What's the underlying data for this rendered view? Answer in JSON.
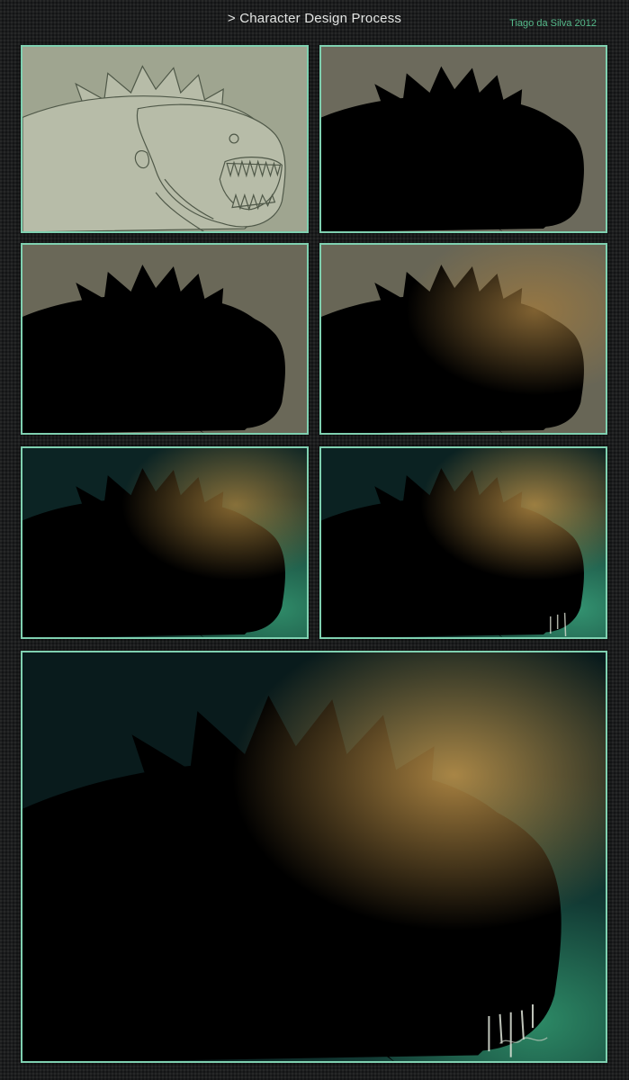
{
  "header": {
    "title": "> Character Design Process",
    "author": "Tiago da Silva 2012"
  },
  "stages": [
    {
      "name": "sketch"
    },
    {
      "name": "flat-color"
    },
    {
      "name": "base-shading"
    },
    {
      "name": "lighting"
    },
    {
      "name": "background-color"
    },
    {
      "name": "details"
    },
    {
      "name": "final-render"
    }
  ],
  "colors": {
    "accent_border": "#7fd0b0",
    "author_text": "#55b98a",
    "background": "#1c1d1e",
    "sketch_paper": "#9fa590",
    "bg_gray": "#6c6a5c",
    "bg_teal": "#0d2a2a"
  }
}
